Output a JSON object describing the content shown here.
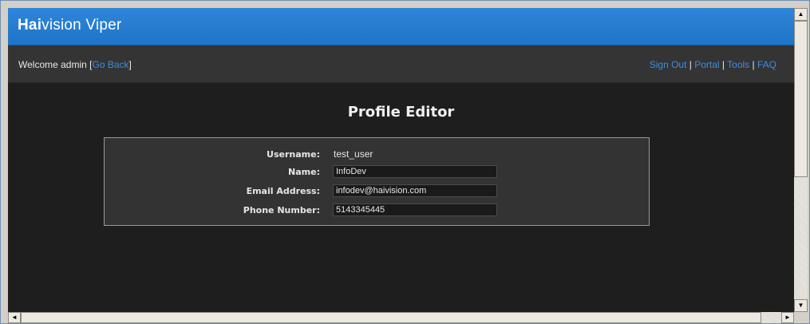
{
  "header": {
    "brand_bold": "Hai",
    "brand_rest": "vision Viper"
  },
  "welcome_bar": {
    "welcome_text": "Welcome admin [",
    "go_back_label": "Go Back",
    "close_bracket": "]",
    "links": [
      "Sign Out",
      "Portal",
      "Tools",
      "FAQ"
    ],
    "separator": " | "
  },
  "page": {
    "title": "Profile Editor"
  },
  "profile": {
    "username_label": "Username:",
    "username_value": "test_user",
    "name_label": "Name:",
    "name_value": "InfoDev",
    "email_label": "Email Address:",
    "email_value": "infodev@haivision.com",
    "phone_label": "Phone Number:",
    "phone_value": "5143345445"
  },
  "scrollbars": {
    "up_arrow": "▲",
    "down_arrow": "▼",
    "left_arrow": "◄",
    "right_arrow": "►"
  },
  "colors": {
    "topbar": "#1e74c8",
    "link": "#3a8ee6",
    "background": "#1e1e1e",
    "panel": "#333333"
  }
}
